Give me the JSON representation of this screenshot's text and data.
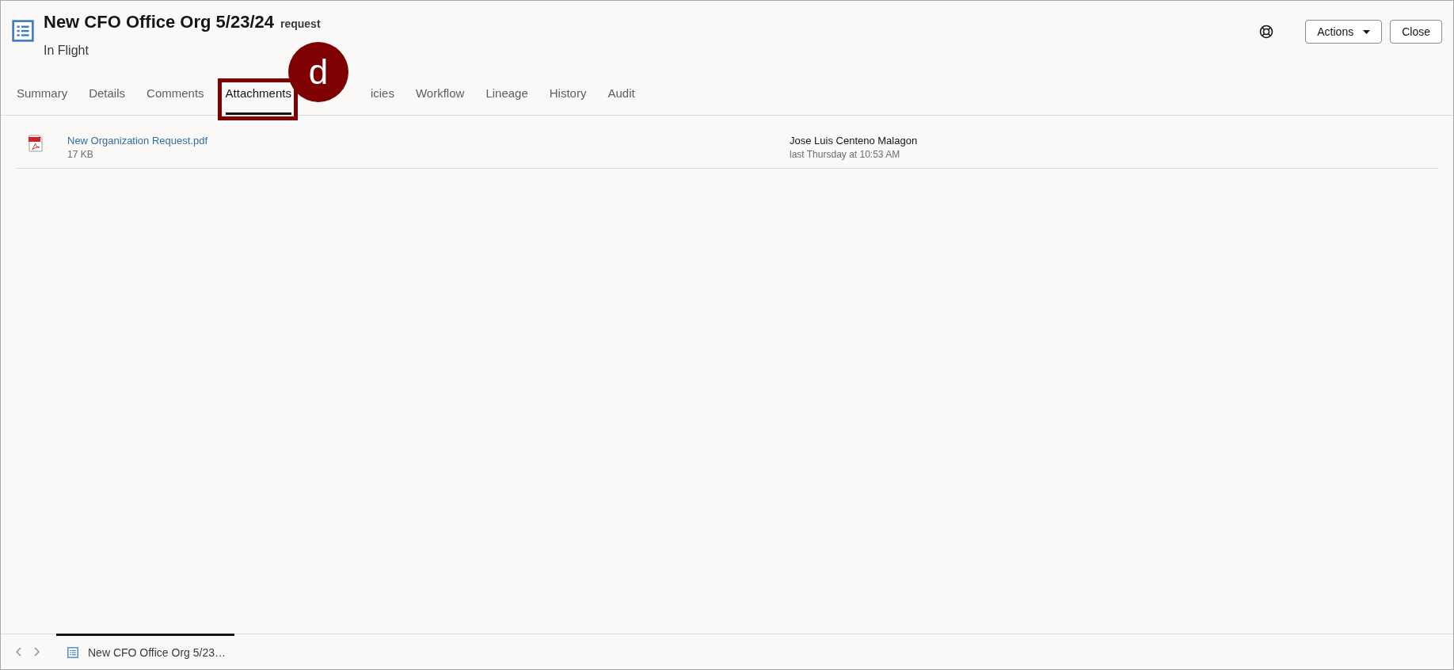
{
  "header": {
    "title": "New CFO Office Org 5/23/24",
    "subtitle": "request",
    "status": "In Flight",
    "actions": [
      {
        "label": "Actions",
        "kind": "menu"
      },
      {
        "label": "Close",
        "kind": "plain"
      }
    ]
  },
  "tabs": [
    {
      "label": "Summary",
      "selected": false
    },
    {
      "label": "Details",
      "selected": false
    },
    {
      "label": "Comments",
      "selected": false
    },
    {
      "label": "Attachments",
      "selected": true,
      "callout": "d"
    },
    {
      "label": "icies",
      "selected": false
    },
    {
      "label": "Workflow",
      "selected": false
    },
    {
      "label": "Lineage",
      "selected": false
    },
    {
      "label": "History",
      "selected": false
    },
    {
      "label": "Audit",
      "selected": false
    }
  ],
  "attachments": [
    {
      "name": "New Organization Request.pdf",
      "size": "17 KB",
      "user": "Jose Luis Centeno Malagon",
      "time": "last Thursday at 10:53 AM"
    }
  ],
  "footer": {
    "tabs": [
      {
        "label": "New CFO Office Org 5/23…",
        "selected": true
      }
    ]
  }
}
